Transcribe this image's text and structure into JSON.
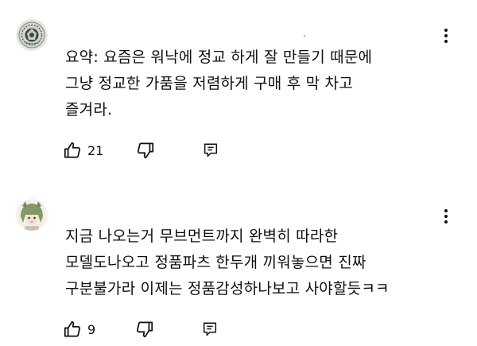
{
  "comments": [
    {
      "lines": [
        "요약: 요즘은 워낙에 정교 하게 잘 만들기 때문에",
        "그냥 정교한 가품을 저렴하게 구매 후 막 차고",
        "즐겨라."
      ],
      "likes": "21",
      "avatar_icon": "emblem-avatar-icon"
    },
    {
      "lines": [
        "지금 나오는거 무브먼트까지 완벽히 따라한",
        "모델도나오고 정품파츠 한두개 끼워놓으면 진짜",
        "구분불가라 이제는 정품감성하나보고 사야할듯ㅋㅋ"
      ],
      "likes": "9",
      "avatar_icon": "anime-character-avatar-icon"
    }
  ],
  "icons": {
    "like": "thumbs-up-icon",
    "dislike": "thumbs-down-icon",
    "reply": "reply-icon",
    "more": "more-vertical-icon"
  },
  "colors": {
    "text": "#0f0f0f",
    "background": "#ffffff"
  }
}
